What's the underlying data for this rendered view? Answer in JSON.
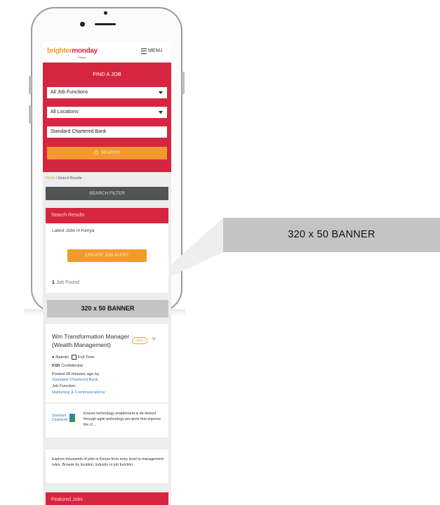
{
  "header": {
    "logo_text_a": "brighter",
    "logo_text_b": "monday",
    "logo_sub": "Kenya",
    "menu_label": "MENU"
  },
  "hero": {
    "title": "FIND A JOB",
    "job_function": "All Job Functions",
    "location": "All Locations",
    "keyword": "Standard Chartered Bank",
    "search_label": "SEARCH"
  },
  "breadcrumb": {
    "home": "Home",
    "separator": " / ",
    "current": "Search Results"
  },
  "filter_label": "SEARCH FILTER",
  "results": {
    "header": "Search Results",
    "latest": "Latest Jobs in Kenya",
    "alert_label": "CREATE JOB ALERT",
    "count": "1",
    "count_suffix": "Job Found"
  },
  "banner": {
    "small_label": "320 x 50 BANNER",
    "big_label": "320 x 50 BANNER"
  },
  "job": {
    "title": "Wm Transformation Manager (Wealth Management)",
    "badge": "NEW",
    "location": "Nairobi",
    "type": "Full Time",
    "salary_currency": "KSh",
    "salary": "Confidential",
    "posted": "Posted 28 minutes ago by:",
    "company": "Standard Chartered Bank",
    "function_label": "Job Function:",
    "function": "Marketing & Communications",
    "company_logo_a": "Standard",
    "company_logo_b": "Chartered",
    "description": "Ensure technology enablement is de-livered through agile technology pro-jects that improve the cl ..."
  },
  "explore_text": "Explore thousands of jobs in Kenya from entry level to management roles. Browse by location, industry or job function.",
  "featured_header": "Featured Jobs",
  "colors": {
    "brand_red": "#d6263f",
    "brand_orange": "#f39a2e",
    "filter_grey": "#505456",
    "banner_grey": "#c4c4c4",
    "link_blue": "#3a7dc2"
  },
  "icons": [
    "menu-icon",
    "chevron-down-icon",
    "search-icon",
    "heart-icon",
    "location-pin-icon",
    "calendar-icon"
  ]
}
